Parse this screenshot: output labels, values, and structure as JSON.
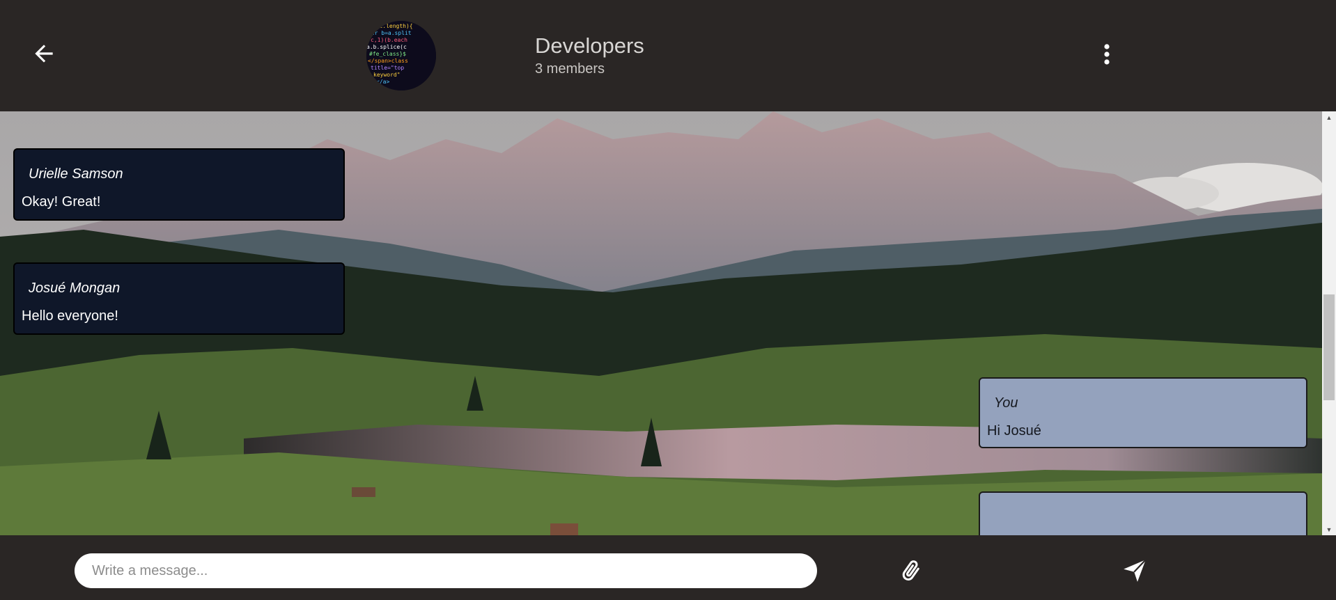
{
  "header": {
    "back_icon": "arrow-left-icon",
    "group_name": "Developers",
    "member_count": "3 members",
    "menu_icon": "more-vertical-icon"
  },
  "messages": [
    {
      "sender": "Urielle Samson",
      "text": "Okay! Great!",
      "mine": false
    },
    {
      "sender": "Josué Mongan",
      "text": "Hello everyone!",
      "mine": false
    },
    {
      "sender": "You",
      "text": "Hi Josué",
      "mine": true
    }
  ],
  "composer": {
    "placeholder": "Write a message...",
    "attach_icon": "paperclip-icon",
    "send_icon": "send-icon"
  },
  "colors": {
    "bar_background": "#2a2625",
    "incoming_bubble": "#0f1729",
    "outgoing_bubble": "#94a2bd"
  }
}
